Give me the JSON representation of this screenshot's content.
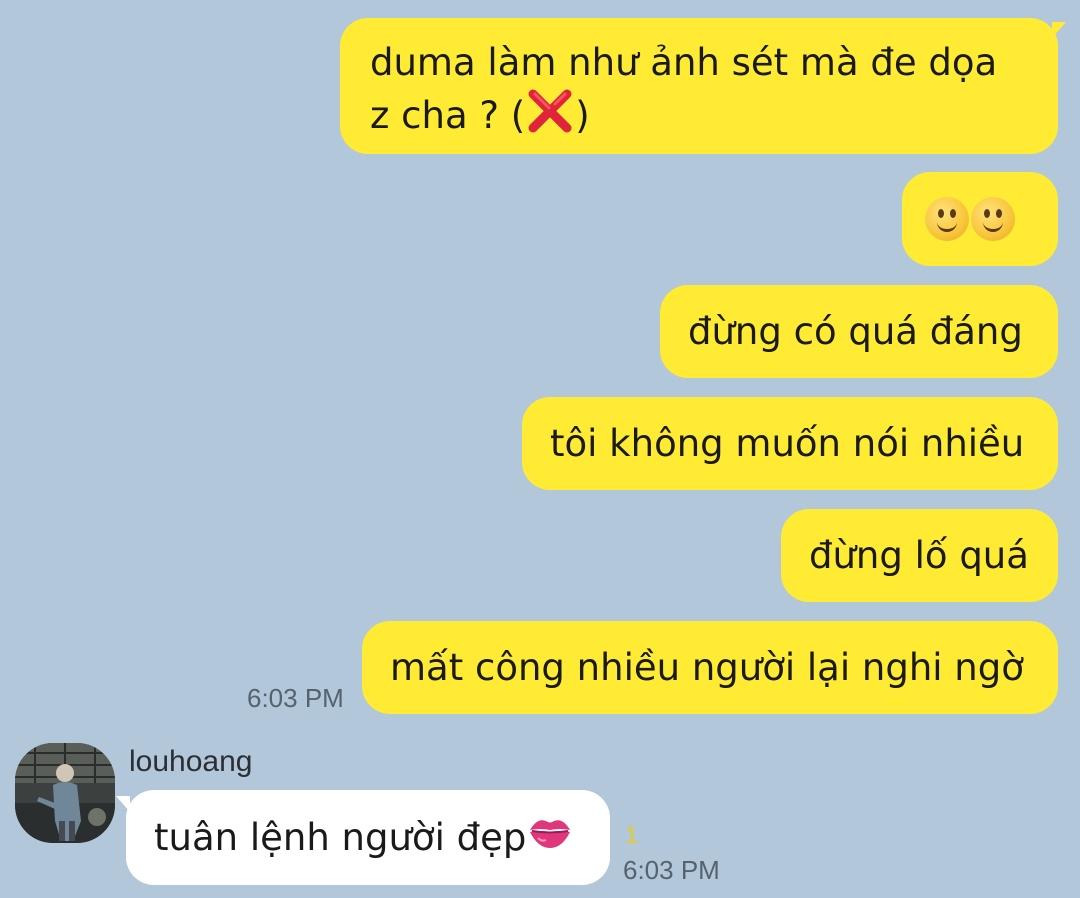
{
  "colors": {
    "background": "#b2c7d9",
    "sent_bubble": "#ffeb33",
    "received_bubble": "#ffffff",
    "unread_count": "#e6cd1f"
  },
  "sent_messages": [
    {
      "text": "duma làm như ảnh sét mà đe dọa z cha ? (",
      "emoji": "cross-mark-emoji",
      "suffix": ")"
    },
    {
      "emoji": "slightly-smiling-face-emoji x2"
    },
    {
      "text": "đừng có quá đáng"
    },
    {
      "text": "tôi không muốn nói nhiều"
    },
    {
      "text": "đừng lố quá"
    },
    {
      "text": "mất công nhiều người lại nghi ngờ"
    }
  ],
  "sent_time": "6:03 PM",
  "received": {
    "sender": "louhoang",
    "avatar": "profile-photo",
    "text": "tuân lệnh người đẹp",
    "emoji": "kiss-mark-emoji",
    "unread": "1",
    "time": "6:03 PM"
  }
}
